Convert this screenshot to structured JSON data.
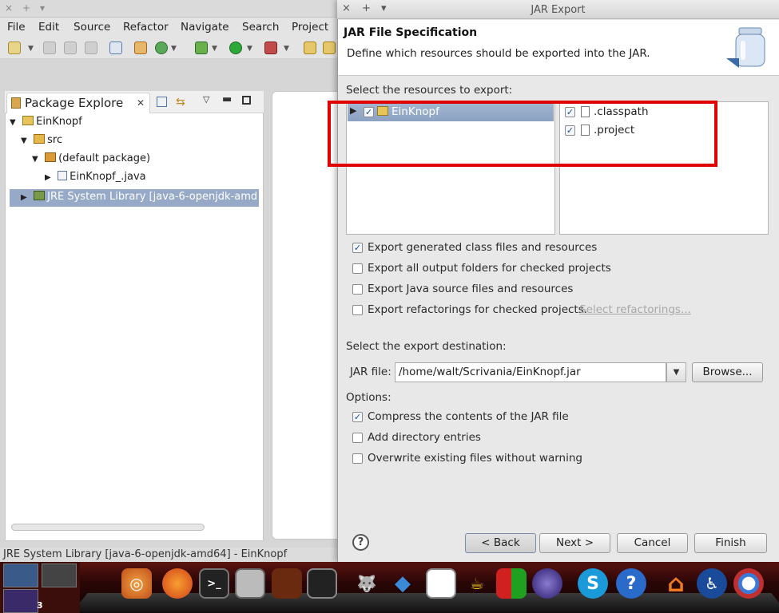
{
  "eclipse": {
    "title_controls": [
      "×",
      "+",
      "▾"
    ],
    "menu": [
      "File",
      "Edit",
      "Source",
      "Refactor",
      "Navigate",
      "Search",
      "Project"
    ],
    "package_explorer": {
      "tab_label": "Package Explore",
      "tree": [
        {
          "label": "EinKnopf",
          "twisty": "▼"
        },
        {
          "label": "src",
          "twisty": "▼"
        },
        {
          "label": "(default package)",
          "twisty": "▼"
        },
        {
          "label": "EinKnopf_.java",
          "twisty": "▶"
        },
        {
          "label": "JRE System Library [java-6-openjdk-amd",
          "twisty": "▶"
        }
      ]
    },
    "status_text": "JRE System Library [java-6-openjdk-amd64] - EinKnopf"
  },
  "dialog": {
    "title": "JAR Export",
    "controls": [
      "×",
      "+",
      "▾"
    ],
    "header_title": "JAR File Specification",
    "header_desc": "Define which resources should be exported into the JAR.",
    "resources_label": "Select the resources to export:",
    "project_name": "EinKnopf",
    "files": [
      {
        "name": ".classpath",
        "checked": true
      },
      {
        "name": ".project",
        "checked": true
      }
    ],
    "export_options": [
      {
        "label": "Export generated class files and resources",
        "checked": true
      },
      {
        "label": "Export all output folders for checked projects",
        "checked": false
      },
      {
        "label": "Export Java source files and resources",
        "checked": false
      },
      {
        "label": "Export refactorings for checked projects.",
        "checked": false
      }
    ],
    "select_refactorings": "Select refactorings...",
    "destination_label": "Select the export destination:",
    "jar_file_label": "JAR file:",
    "jar_file_value": "/home/walt/Scrivania/EinKnopf.jar",
    "browse": "Browse...",
    "options_label": "Options:",
    "options": [
      {
        "label": "Compress the contents of the JAR file",
        "checked": true
      },
      {
        "label": "Add directory entries",
        "checked": false
      },
      {
        "label": "Overwrite existing files without warning",
        "checked": false
      }
    ],
    "buttons": {
      "help": "?",
      "back": "< Back",
      "next": "Next >",
      "cancel": "Cancel",
      "finish": "Finish"
    }
  },
  "dock": {
    "workspace_count": "3",
    "icons": [
      "ubuntu",
      "firefox",
      "terminal",
      "calculator",
      "system-monitor",
      "gimp",
      "dropbox",
      "image-viewer",
      "teapot",
      "game",
      "eclipse",
      "skype",
      "help",
      "home",
      "accessibility",
      "chrome"
    ]
  },
  "colors": {
    "highlight": "#e00000",
    "selection": "#96a9c6"
  }
}
